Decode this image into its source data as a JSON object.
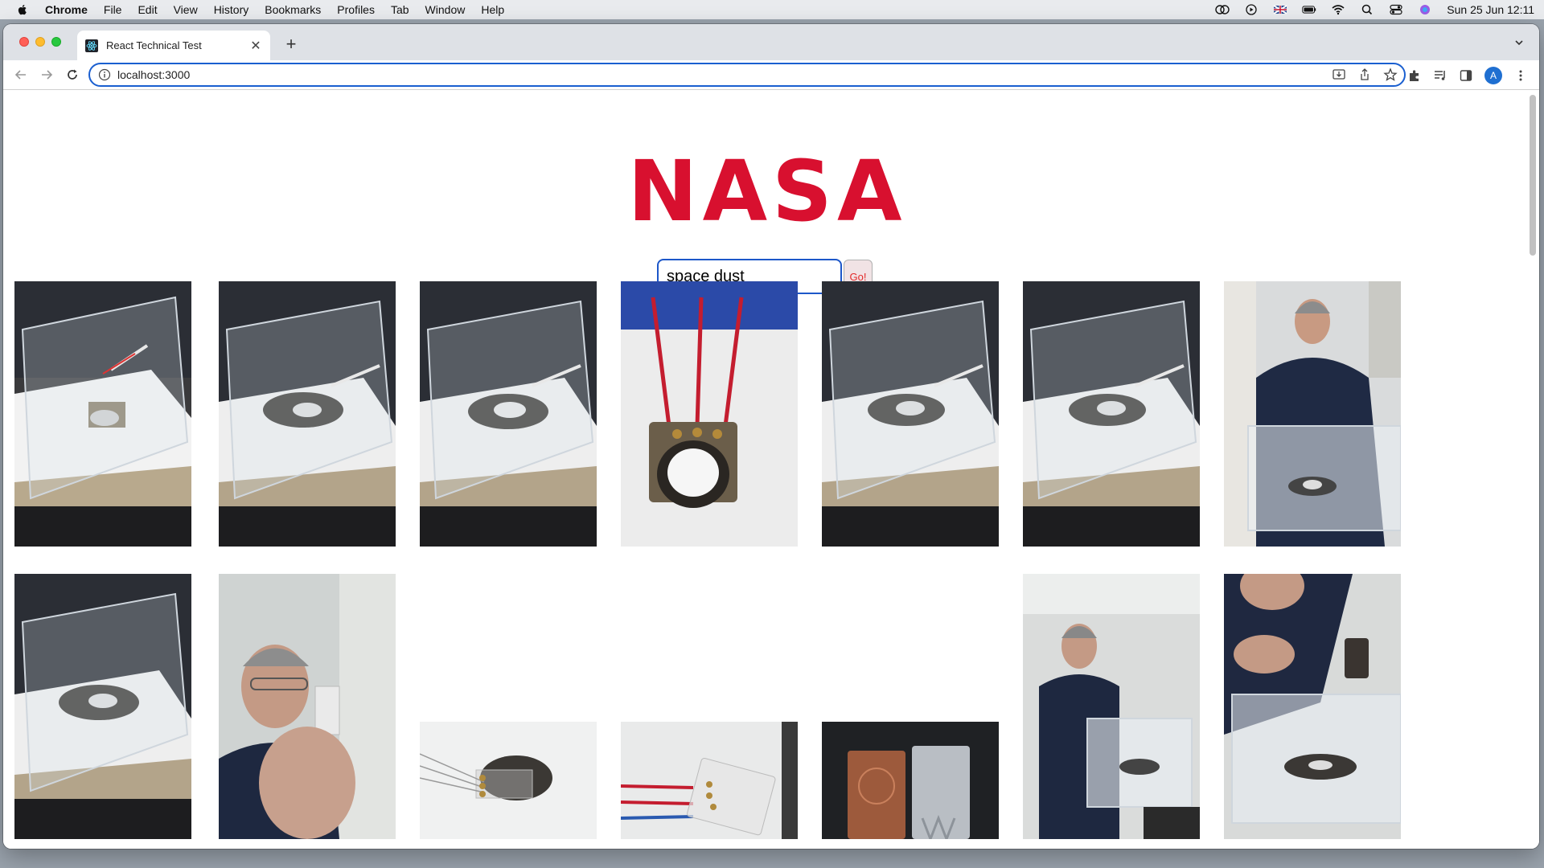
{
  "menubar": {
    "app_name": "Chrome",
    "items": [
      "File",
      "Edit",
      "View",
      "History",
      "Bookmarks",
      "Profiles",
      "Tab",
      "Window",
      "Help"
    ],
    "clock": "Sun 25 Jun  12:11"
  },
  "browser": {
    "tab_title": "React Technical Test",
    "url": "localhost:3000",
    "profile_initial": "A"
  },
  "page": {
    "logo_text": "NASA",
    "search_value": "space dust",
    "go_label": "Go!",
    "images": [
      {
        "subject": "dust chamber with white coated plate"
      },
      {
        "subject": "dust chamber with dark dust patch"
      },
      {
        "subject": "dust chamber with dark dust patch"
      },
      {
        "subject": "sensor plate with white dome and red wires"
      },
      {
        "subject": "dust chamber with dark dust patch"
      },
      {
        "subject": "dust chamber with dark dust patch"
      },
      {
        "subject": "scientist standing beside dust chamber"
      },
      {
        "subject": "dust chamber with dark dust patch"
      },
      {
        "subject": "scientist holding up a sample slide"
      },
      {
        "subject": "sensor slide with dust"
      },
      {
        "subject": "sensor slide with wires"
      },
      {
        "subject": "two sensor plates side by side"
      },
      {
        "subject": "scientist pouring dust into chamber"
      },
      {
        "subject": "close-up pouring dust into chamber"
      }
    ]
  },
  "colors": {
    "accent_blue": "#1d57c9",
    "nasa_red": "#d8102f",
    "go_text": "#e32a2a"
  }
}
